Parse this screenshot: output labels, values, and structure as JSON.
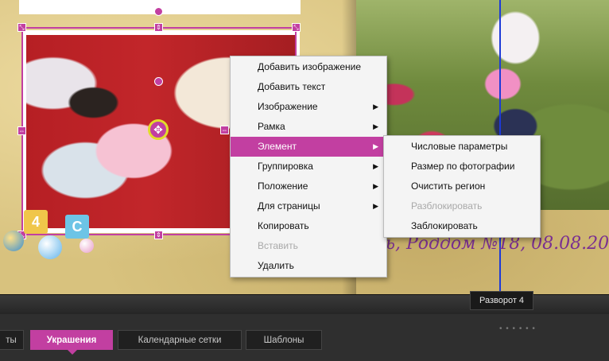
{
  "context_menu": {
    "items": [
      {
        "label": "Добавить изображение",
        "submenu": false,
        "state": "normal"
      },
      {
        "label": "Добавить текст",
        "submenu": false,
        "state": "normal"
      },
      {
        "label": "Изображение",
        "submenu": true,
        "state": "normal"
      },
      {
        "label": "Рамка",
        "submenu": true,
        "state": "normal"
      },
      {
        "label": "Элемент",
        "submenu": true,
        "state": "active"
      },
      {
        "label": "Группировка",
        "submenu": true,
        "state": "normal"
      },
      {
        "label": "Положение",
        "submenu": true,
        "state": "normal"
      },
      {
        "label": "Для страницы",
        "submenu": true,
        "state": "normal"
      },
      {
        "label": "Копировать",
        "submenu": false,
        "state": "normal"
      },
      {
        "label": "Вставить",
        "submenu": false,
        "state": "disabled"
      },
      {
        "label": "Удалить",
        "submenu": false,
        "state": "normal"
      }
    ],
    "arrow_glyph": "▶"
  },
  "submenu": {
    "items": [
      {
        "label": "Числовые параметры",
        "state": "normal"
      },
      {
        "label": "Размер по фотографии",
        "state": "normal"
      },
      {
        "label": "Очистить регион",
        "state": "normal"
      },
      {
        "label": "Разблокировать",
        "state": "disabled"
      },
      {
        "label": "Заблокировать",
        "state": "normal"
      }
    ]
  },
  "canvas": {
    "caption_text": "ь, Роддом №18, 08.08.20",
    "spread_tooltip": "Разворот 4",
    "decor_blocks": [
      "4",
      "C"
    ],
    "handle_glyphs": {
      "corner": "⤡",
      "side_v": "⇕",
      "side_h": "⇔",
      "move": "✥"
    }
  },
  "bottom_tabs": [
    {
      "label": "ты",
      "state": "normal"
    },
    {
      "label": "Украшения",
      "state": "active"
    },
    {
      "label": "Календарные сетки",
      "state": "normal"
    },
    {
      "label": "Шаблоны",
      "state": "normal"
    }
  ],
  "colors": {
    "accent": "#c23fa1",
    "guide": "#1d3ad8",
    "paper": "#d8c27e",
    "caption": "#7a2f91"
  }
}
